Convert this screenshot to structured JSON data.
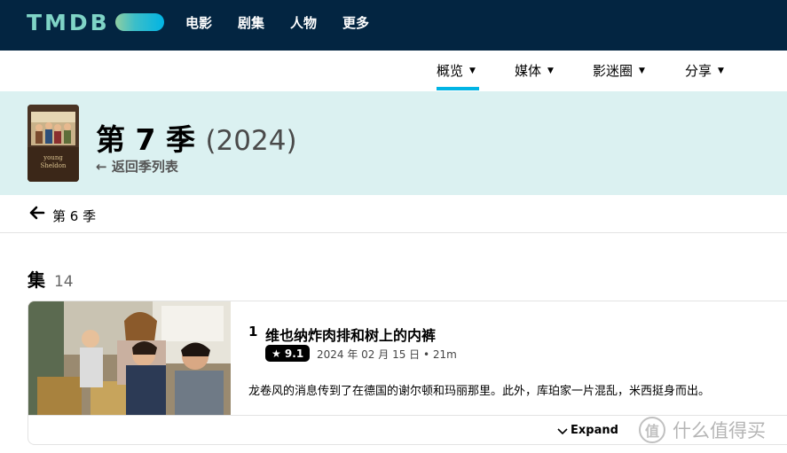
{
  "header": {
    "logo_text": "TMDB",
    "nav": [
      "电影",
      "剧集",
      "人物",
      "更多"
    ]
  },
  "subnav": {
    "items": [
      {
        "label": "概览",
        "active": true
      },
      {
        "label": "媒体",
        "active": false
      },
      {
        "label": "影迷圈",
        "active": false
      },
      {
        "label": "分享",
        "active": false
      }
    ]
  },
  "season": {
    "poster_text_line1": "young",
    "poster_text_line2": "Sheldon",
    "title": "第 7 季",
    "year": "(2024)",
    "back_label": "返回季列表"
  },
  "prev_season": {
    "label": "第 6 季"
  },
  "episodes": {
    "heading": "集",
    "count": "14",
    "items": [
      {
        "number": "1",
        "title": "维也纳炸肉排和树上的内裤",
        "rating": "★ 9.1",
        "meta": "2024 年 02 月 15 日 • 21m",
        "overview": "龙卷风的消息传到了在德国的谢尔顿和玛丽那里。此外，库珀家一片混乱，米西挺身而出。",
        "expand_label": "Expand"
      }
    ]
  },
  "watermark": {
    "badge": "值",
    "text": "什么值得买"
  },
  "colors": {
    "header_bg": "#032541",
    "accent": "#01b4e4",
    "banner_bg": "#dbf1f1"
  }
}
